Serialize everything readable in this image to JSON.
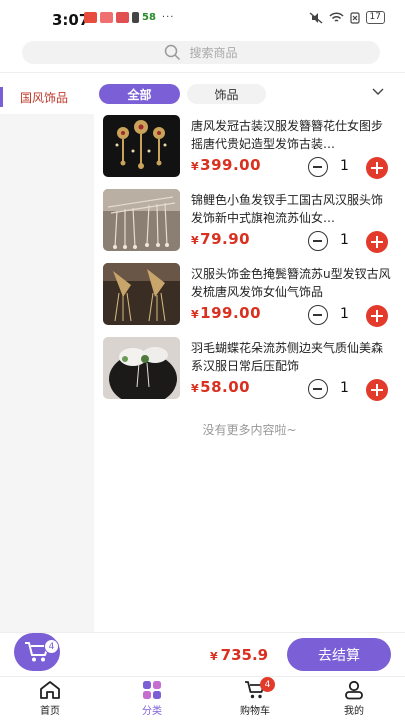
{
  "status_bar": {
    "time": "3:07",
    "app_badge": "58",
    "more": "···",
    "battery": "17"
  },
  "search": {
    "placeholder": "搜索商品"
  },
  "sidebar": {
    "items": [
      {
        "label": "国风饰品",
        "active": true
      }
    ]
  },
  "filters": [
    {
      "label": "全部",
      "active": true
    },
    {
      "label": "饰品",
      "active": false
    }
  ],
  "products": [
    {
      "title": "唐风发冠古装汉服发簪簪花仕女图步摇唐代贵妃造型发饰古装…",
      "currency": "¥",
      "price": "399.00",
      "qty": "1"
    },
    {
      "title": "锦鲤色小鱼发钗手工国古风汉服头饰发饰新中式旗袍流苏仙女…",
      "currency": "¥",
      "price": "79.90",
      "qty": "1"
    },
    {
      "title": "汉服头饰金色掩鬓簪流苏u型发钗古风发梳唐风发饰女仙气饰品",
      "currency": "¥",
      "price": "199.00",
      "qty": "1"
    },
    {
      "title": "羽毛蝴蝶花朵流苏侧边夹气质仙美森系汉服日常后压配饰",
      "currency": "¥",
      "price": "58.00",
      "qty": "1"
    }
  ],
  "no_more_text": "没有更多内容啦~",
  "cart": {
    "badge": "4",
    "currency": "¥",
    "total": "735.9",
    "checkout_label": "去结算"
  },
  "tabbar": {
    "items": [
      {
        "label": "首页",
        "icon": "home-icon"
      },
      {
        "label": "分类",
        "icon": "category-icon",
        "active": true
      },
      {
        "label": "购物车",
        "icon": "cart-icon",
        "badge": "4"
      },
      {
        "label": "我的",
        "icon": "profile-icon"
      }
    ]
  },
  "colors": {
    "accent": "#7b5fd6",
    "price": "#d9301f",
    "plus_button": "#e33b2b"
  }
}
